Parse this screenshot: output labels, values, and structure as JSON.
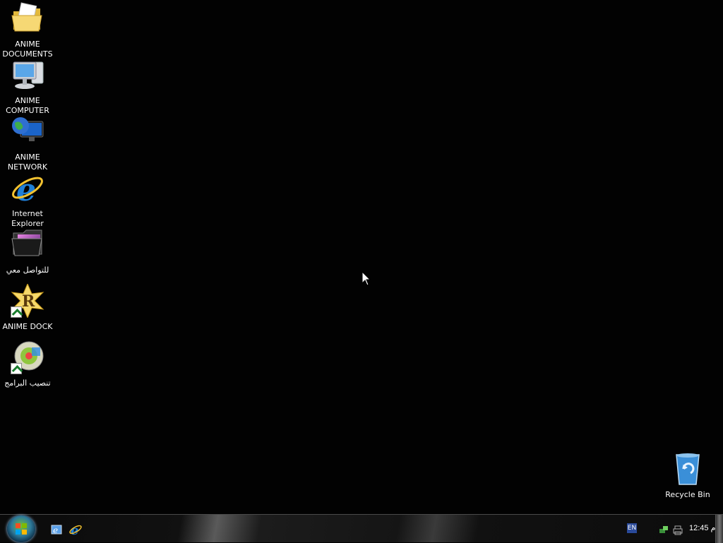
{
  "desktop": {
    "icons": [
      {
        "label": "ANIME\nDOCUMENTS",
        "icon": "folder-documents-icon"
      },
      {
        "label": "ANIME\nCOMPUTER",
        "icon": "computer-icon"
      },
      {
        "label": "ANIME\nNETWORK",
        "icon": "network-globe-icon"
      },
      {
        "label": "Internet\nExplorer",
        "icon": "internet-explorer-icon"
      },
      {
        "label": "للتواصل معي",
        "icon": "dark-folder-icon"
      },
      {
        "label": "ANIME DOCK",
        "icon": "rocket-dock-shortcut-icon"
      },
      {
        "label": "تنصيب البرامج",
        "icon": "install-programs-shortcut-icon"
      }
    ],
    "recycle_bin": {
      "label": "Recycle Bin",
      "icon": "recycle-bin-icon"
    }
  },
  "taskbar": {
    "start_icon": "windows-start-orb-icon",
    "quick_launch": [
      {
        "icon": "show-desktop-quicklaunch-icon"
      },
      {
        "icon": "internet-explorer-quicklaunch-icon"
      }
    ],
    "tray": {
      "language": "EN",
      "icons": [
        "network-tray-icon",
        "printer-tray-icon"
      ],
      "clock": "12:45 م"
    }
  },
  "colors": {
    "desktop_bg": "#020202",
    "ie_blue": "#1f7fd8",
    "folder_yellow": "#f2d46b"
  }
}
